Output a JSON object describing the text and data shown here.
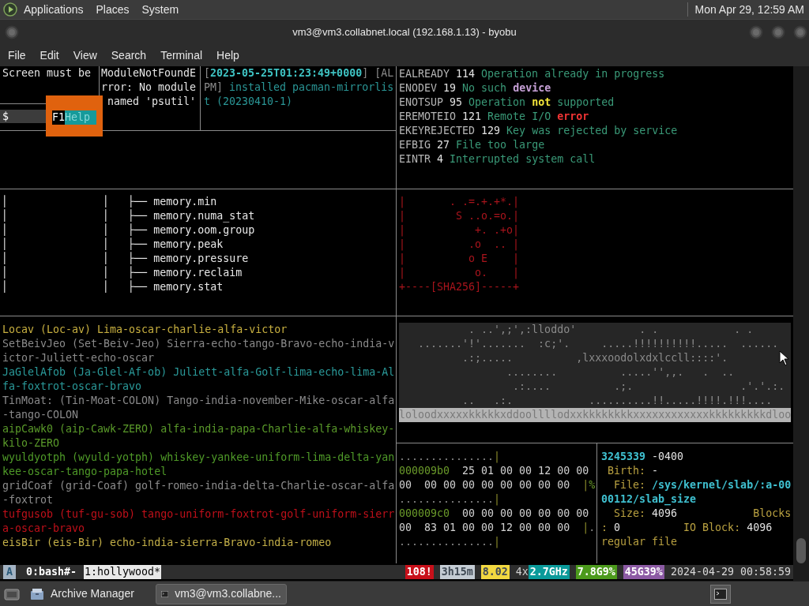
{
  "top_panel": {
    "menus": [
      "Applications",
      "Places",
      "System"
    ],
    "clock": "Mon Apr 29, 12:59 AM"
  },
  "window": {
    "title": "vm3@vm3.collabnet.local (192.168.1.13) - byobu"
  },
  "menu_bar": [
    "File",
    "Edit",
    "View",
    "Search",
    "Terminal",
    "Help"
  ],
  "panes": {
    "screen_notice": {
      "lines": [
        "Screen must be"
      ],
      "prompt": "$",
      "popup": {
        "key": "F1",
        "label": "Help"
      }
    },
    "python_error": {
      "lines": [
        "ModuleNotFoundE",
        "rror: No module",
        " named 'psutil'"
      ]
    },
    "pacman_log": {
      "lines": [
        [
          {
            "text": "[",
            "kind": "bracket"
          },
          {
            "text": "2023-05-25T01:23:49+0000",
            "kind": "timestamp"
          },
          {
            "text": "] [AL",
            "kind": "bracket"
          }
        ],
        [
          {
            "text": "PM]",
            "kind": "bracket"
          },
          {
            "text": " installed pacman-mirrorlis",
            "kind": "log"
          }
        ],
        [
          {
            "text": "t (20230410-1)",
            "kind": "log"
          }
        ]
      ]
    },
    "errno_list": {
      "lines": [
        [
          {
            "text": "EALREADY",
            "kind": "code"
          },
          {
            "text": " 114 ",
            "kind": "number"
          },
          {
            "text": "Operation already in progress",
            "kind": "message"
          }
        ],
        [
          {
            "text": "ENODEV",
            "kind": "code"
          },
          {
            "text": " 19 ",
            "kind": "number"
          },
          {
            "text": "No such ",
            "kind": "message"
          },
          {
            "text": "device",
            "kind": "noun"
          }
        ],
        [
          {
            "text": "ENOTSUP",
            "kind": "code"
          },
          {
            "text": " 95 ",
            "kind": "number"
          },
          {
            "text": "Operation ",
            "kind": "message"
          },
          {
            "text": "not",
            "kind": "negation"
          },
          {
            "text": " supported",
            "kind": "message"
          }
        ],
        [
          {
            "text": "EREMOTEIO",
            "kind": "code"
          },
          {
            "text": " 121 ",
            "kind": "number"
          },
          {
            "text": "Remote I/O ",
            "kind": "message"
          },
          {
            "text": "error",
            "kind": "error"
          }
        ],
        [
          {
            "text": "EKEYREJECTED",
            "kind": "code"
          },
          {
            "text": " 129 ",
            "kind": "number"
          },
          {
            "text": "Key was rejected by service",
            "kind": "message"
          }
        ],
        [
          {
            "text": "EFBIG",
            "kind": "code"
          },
          {
            "text": " 27 ",
            "kind": "number"
          },
          {
            "text": "File too large",
            "kind": "message"
          }
        ],
        [
          {
            "text": "EINTR",
            "kind": "code"
          },
          {
            "text": " 4 ",
            "kind": "number"
          },
          {
            "text": "Interrupted system call",
            "kind": "message"
          }
        ]
      ]
    },
    "tree": {
      "lines": [
        "│               │   ├── memory.min",
        "│               │   ├── memory.numa_stat",
        "│               │   ├── memory.oom.group",
        "│               │   ├── memory.peak",
        "│               │   ├── memory.pressure",
        "│               │   ├── memory.reclaim",
        "│               │   ├── memory.stat"
      ]
    },
    "randomart": {
      "lines": [
        "|       . .=.+.+*.|",
        "|        S ..o.=o.|",
        "|           +. .+o|",
        "|          .o  .. |",
        "|          o E    |",
        "|           o.    |",
        "+----[SHA256]-----+"
      ]
    },
    "word_list": {
      "entries": [
        {
          "text": "Locav (Loc-av) Lima-oscar-charlie-alfa-victor",
          "color": "#c8b040"
        },
        {
          "text": "SetBeivJeo (Set-Beiv-Jeo) Sierra-echo-tango-Bravo-echo-india-victor-Juliett-echo-oscar",
          "color": "#8a8a8a"
        },
        {
          "text": "JaGlelAfob (Ja-Glel-Af-ob) Juliett-alfa-Golf-lima-echo-lima-Alfa-foxtrot-oscar-bravo",
          "color": "#2a9a9a"
        },
        {
          "text": "TinMoat: (Tin-Moat-COLON) Tango-india-november-Mike-oscar-alfa-tango-COLON",
          "color": "#8a8a8b"
        },
        {
          "text": "aipCawk0 (aip-Cawk-ZERO) alfa-india-papa-Charlie-alfa-whiskey-kilo-ZERO",
          "color": "#5a9a2a"
        },
        {
          "text": "wyuldyotph (wyuld-yotph) whiskey-yankee-uniform-lima-delta-yankee-oscar-tango-papa-hotel",
          "color": "#4f9a28"
        },
        {
          "text": "gridCoaf (grid-Coaf) golf-romeo-india-delta-Charlie-oscar-alfa-foxtrot",
          "color": "#8c8c8c"
        },
        {
          "text": "tufgusob (tuf-gu-sob) tango-uniform-foxtrot-golf-uniform-sierra-oscar-bravo",
          "color": "#c0101a"
        },
        {
          "text": "eisBir (eis-Bir) echo-india-sierra-Bravo-india-romeo",
          "color": "#c4b048"
        }
      ]
    },
    "ascii_image": {
      "rows": [
        {
          "text": "           . ..',;',:lloddo'          . .            . .",
          "kind": "dots"
        },
        {
          "text": "   .......'!'.......  :c;'.     .....!!!!!!!!!!.....  ......",
          "kind": "dots"
        },
        {
          "text": "          .:;.....          ,lxxxoodolxdxlccll::::'.",
          "kind": "dots"
        },
        {
          "text": "                 ........          .....'',,.   .  ..",
          "kind": "dots"
        },
        {
          "text": "                  .:....          .;.                 .'.'.:.",
          "kind": "dots"
        },
        {
          "text": "          ..   .:.            ..........!!.....!!!!.!!!....",
          "kind": "dots"
        },
        {
          "text": "loloodxxxxxkkkkkxddoollllodxxkkkkkkkkxxxxxxxxxxxxkkkkkkkkkdloo",
          "kind": "band"
        }
      ]
    },
    "hexdump": {
      "lines": [
        [
          {
            "text": "...............",
            "kind": "dots"
          },
          {
            "text": "|",
            "kind": "pipe"
          }
        ],
        [
          {
            "text": "000009b0",
            "kind": "address"
          },
          {
            "text": "  25 01 00 00 12 00 00",
            "kind": "bytes"
          }
        ],
        [
          {
            "text": "00  00 00 00 00 00 00 00 00  ",
            "kind": "bytes"
          },
          {
            "text": "|",
            "kind": "pipe"
          },
          {
            "text": "%",
            "kind": "address"
          }
        ],
        [
          {
            "text": "...............",
            "kind": "dots"
          },
          {
            "text": "|",
            "kind": "pipe"
          }
        ],
        [
          {
            "text": "000009c0",
            "kind": "address"
          },
          {
            "text": "  00 00 00 00 00 00 00",
            "kind": "bytes"
          }
        ],
        [
          {
            "text": "00  83 01 00 00 12 00 00 00  ",
            "kind": "bytes"
          },
          {
            "text": "|",
            "kind": "pipe"
          },
          {
            "text": ".",
            "kind": "dots"
          }
        ],
        [
          {
            "text": "...............",
            "kind": "dots"
          },
          {
            "text": "|",
            "kind": "pipe"
          }
        ]
      ]
    },
    "stat": {
      "lines": [
        [
          {
            "text": "3245339",
            "kind": "path"
          },
          {
            "text": " -0400",
            "kind": "number"
          }
        ],
        [
          {
            "text": " Birth:",
            "kind": "label"
          },
          {
            "text": " -",
            "kind": "number"
          }
        ],
        [
          {
            "text": "  File: ",
            "kind": "label"
          },
          {
            "text": "/sys/kernel/slab/:a-00",
            "kind": "path"
          }
        ],
        [
          {
            "text": "00112/slab_size",
            "kind": "path"
          }
        ],
        [
          {
            "text": "  Size:",
            "kind": "label"
          },
          {
            "text": " 4096",
            "kind": "number"
          },
          {
            "text": "            Blocks",
            "kind": "label"
          }
        ],
        [
          {
            "text": ":",
            "kind": "label"
          },
          {
            "text": " 0",
            "kind": "number"
          },
          {
            "text": "          IO Block:",
            "kind": "label"
          },
          {
            "text": " 4096",
            "kind": "number"
          }
        ],
        [
          {
            "text": "regular file",
            "kind": "label"
          }
        ]
      ]
    }
  },
  "status_bar": {
    "session": "A",
    "windows": [
      {
        "label": "0:bash#-",
        "selected": false
      },
      {
        "label": "1:hollywood*",
        "selected": true
      }
    ],
    "indicators": [
      {
        "text": "108!",
        "color": "#c8101a"
      },
      {
        "text": "3h15m",
        "color": "#c4ccd4"
      },
      {
        "text": "8.02",
        "color": "#f2d840"
      },
      {
        "text": "4x"
      },
      {
        "text": "2.7GHz",
        "color": "#0a9a9a"
      },
      {
        "text": "7.8G9%",
        "color": "#4c9a1c"
      },
      {
        "text": "45G39%",
        "color": "#8c5aa4"
      }
    ],
    "clock": "2024-04-29 00:58:59"
  },
  "taskbar": {
    "items": [
      {
        "label": "Archive Manager",
        "selected": false
      },
      {
        "label": "vm3@vm3.collabne...",
        "selected": true
      }
    ]
  }
}
